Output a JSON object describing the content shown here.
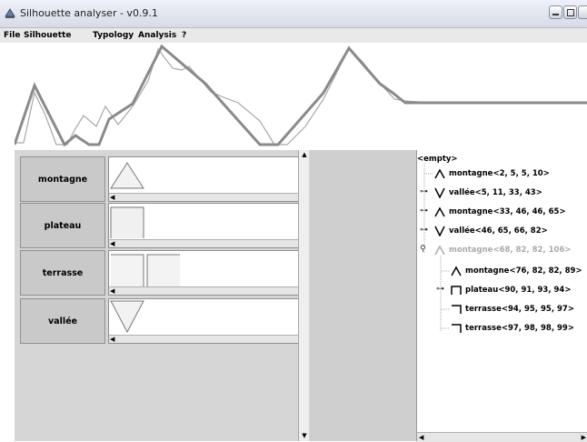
{
  "window": {
    "title": "Silhouette analyser - v0.9.1"
  },
  "menu": [
    "File",
    "Silhouette",
    "Typology",
    "Analysis",
    "?"
  ],
  "patterns": [
    {
      "label": "montagne",
      "shape": "montagne"
    },
    {
      "label": "plateau",
      "shape": "plateau"
    },
    {
      "label": "terrasse",
      "shape": "terrasse"
    },
    {
      "label": "vallée",
      "shape": "vallee"
    }
  ],
  "tree": {
    "root": "<empty>",
    "nodes": [
      {
        "text": "montagne<2, 5, 5, 10>",
        "icon": "montagne-icon",
        "expander": "",
        "muted": false
      },
      {
        "text": "vallée<5, 11, 33, 43>",
        "icon": "vallee-icon",
        "expander": "collapsed",
        "muted": false
      },
      {
        "text": "montagne<33, 46, 46, 65>",
        "icon": "montagne-icon",
        "expander": "collapsed",
        "muted": false
      },
      {
        "text": "vallée<46, 65, 66, 82>",
        "icon": "vallee-icon",
        "expander": "collapsed",
        "muted": false
      },
      {
        "text": "montagne<68, 82, 82, 106>",
        "icon": "montagne-icon",
        "expander": "expanded",
        "muted": true
      },
      {
        "text": "montagne<76, 82, 82, 89>",
        "icon": "montagne-icon",
        "expander": "",
        "muted": false
      },
      {
        "text": "plateau<90, 91, 93, 94>",
        "icon": "plateau-icon",
        "expander": "collapsed",
        "muted": false
      },
      {
        "text": "terrasse<94, 95, 95, 97>",
        "icon": "terrasse-icon",
        "expander": "",
        "muted": false
      },
      {
        "text": "terrasse<97, 98, 98, 99>",
        "icon": "terrasse-icon",
        "expander": "",
        "muted": false
      }
    ]
  },
  "colors": {
    "silhouette_bold": "#8a8a8a",
    "silhouette_thin": "#a8a8a8",
    "panel_gray": "#d6d6d6"
  }
}
